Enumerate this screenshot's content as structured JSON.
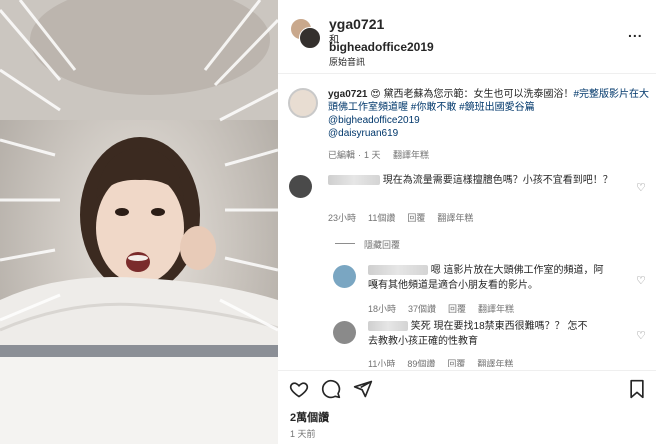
{
  "post": {
    "header": {
      "username1": "yga0721",
      "and": "和",
      "username2": "bigheadoffice2019",
      "audio": "原始音訊",
      "more": "..."
    },
    "caption": {
      "username": "yga0721",
      "emoji": "😍",
      "text": "黛西老蘇為您示範：女生也可以洗泰國浴！",
      "hashtag1": "#完整版影片在大頭佛工作室頻道喔",
      "hashtag2": "#你敢不敢",
      "hashtag3": "#鏡班出國愛谷篇",
      "mention1": "@bigheadoffice2019",
      "mention2": "@daisyruan619",
      "edited": "已編輯",
      "dot": "·",
      "time": "1 天",
      "translate": "翻譯年糕"
    },
    "comments": [
      {
        "text": "現在為流量需要這樣擅膻色嗎？小孩不宜看到吧！？",
        "time": "23小時",
        "likes": "11個讚",
        "reply": "回覆",
        "translate": "翻譯年糕"
      }
    ],
    "hidden_replies": "隱藏回覆",
    "replies": [
      {
        "text_a": "嗯 這影片放在大頭佛工作室的頻道，阿",
        "text_b": "嘎有其他頻道是適合小朋友看的影片。",
        "time": "18小時",
        "likes": "37個讚",
        "reply": "回覆",
        "translate": "翻譯年糕"
      },
      {
        "text_a": "笑死 現在要找18禁東西很難嗎？？ 怎不",
        "text_b": "去教教小孩正確的性教育",
        "time": "11小時",
        "likes": "89個讚",
        "reply": "回覆",
        "translate": "翻譯年糕"
      }
    ],
    "views": "2萬個讚",
    "posted": "1 天前",
    "icons": {
      "heart": "heart-icon",
      "comment": "comment-icon",
      "share": "share-icon",
      "save": "bookmark-icon"
    }
  }
}
